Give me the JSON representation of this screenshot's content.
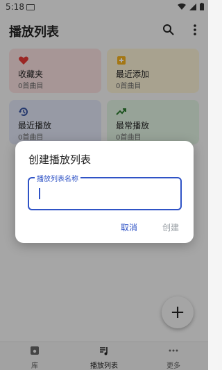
{
  "status_bar": {
    "time": "5:18"
  },
  "app_bar": {
    "title": "播放列表"
  },
  "cards": [
    {
      "name": "收藏夹",
      "count": "0首曲目",
      "icon": "heart-icon",
      "bg": "#f6dede",
      "icon_color": "#e53935"
    },
    {
      "name": "最近添加",
      "count": "0首曲目",
      "icon": "playlist-add-icon",
      "bg": "#f8efd3",
      "icon_color": "#f2b01e"
    },
    {
      "name": "最近播放",
      "count": "0首曲目",
      "icon": "history-icon",
      "bg": "#dfe4f4",
      "icon_color": "#3955a3"
    },
    {
      "name": "最常播放",
      "count": "0首曲目",
      "icon": "trending-up-icon",
      "bg": "#dff0e0",
      "icon_color": "#2e7d32"
    }
  ],
  "bottom_nav": {
    "items": [
      {
        "label": "库",
        "icon": "library-icon"
      },
      {
        "label": "播放列表",
        "icon": "playlist-icon",
        "active": true
      },
      {
        "label": "更多",
        "icon": "more-horiz-icon"
      }
    ]
  },
  "fab": {
    "label": "+"
  },
  "dialog": {
    "title": "创建播放列表",
    "field_label": "播放列表名称",
    "cancel": "取消",
    "create": "创建"
  },
  "colors": {
    "accent": "#2f53c6",
    "disabled": "#9aa0a6"
  }
}
